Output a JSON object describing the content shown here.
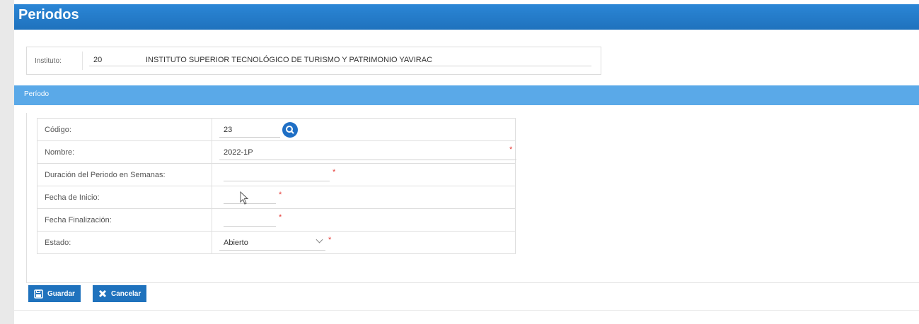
{
  "header": {
    "title": "Periodos"
  },
  "institute": {
    "label": "Instituto:",
    "code": "20",
    "name": "INSTITUTO SUPERIOR TECNOLÓGICO DE TURISMO Y PATRIMONIO YAVIRAC"
  },
  "section": {
    "title": "Período"
  },
  "form": {
    "codigo": {
      "label": "Código:",
      "value": "23"
    },
    "nombre": {
      "label": "Nombre:",
      "value": "2022-1P"
    },
    "duracion": {
      "label": "Duración del Periodo en Semanas:",
      "value": ""
    },
    "fecha_inicio": {
      "label": "Fecha de Inicio:",
      "value": ""
    },
    "fecha_fin": {
      "label": "Fecha Finalización:",
      "value": ""
    },
    "estado": {
      "label": "Estado:",
      "value": "Abierto"
    },
    "required_mark": "*"
  },
  "actions": {
    "save": "Guardar",
    "cancel": "Cancelar"
  },
  "icons": {
    "search": "search-icon",
    "chevron": "chevron-down-icon",
    "save": "floppy-disk-icon",
    "cancel": "close-icon",
    "cursor": "mouse-cursor-icon"
  },
  "colors": {
    "header_bar": "#1f72bd",
    "section_bar": "#5aa9e8",
    "button": "#1f72bd",
    "required": "#e53935"
  }
}
